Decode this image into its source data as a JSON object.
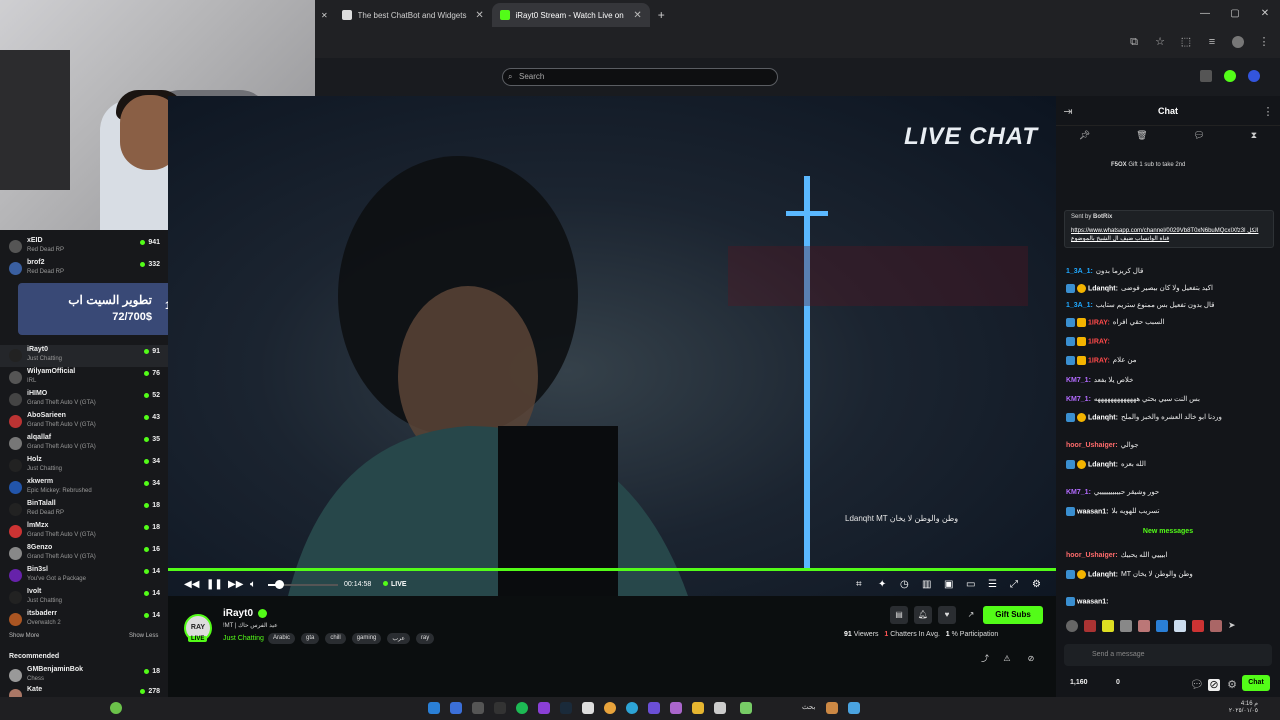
{
  "browser": {
    "tabs": [
      {
        "title": "The best ChatBot and Widgets for Kick, Tw...",
        "active": false
      },
      {
        "title": "iRayt0 Stream - Watch Live on Kick",
        "active": true
      }
    ],
    "new_tab": "+"
  },
  "header": {
    "search_placeholder": "Search"
  },
  "sidebar": {
    "channels": [
      {
        "name": "xEID",
        "game": "Red Dead RP",
        "viewers": "941"
      },
      {
        "name": "brof2",
        "game": "Red Dead RP",
        "viewers": "332"
      },
      {
        "name": "iRayt0",
        "game": "Just Chatting",
        "viewers": "91"
      },
      {
        "name": "WilyamOfficial",
        "game": "IRL",
        "viewers": "76"
      },
      {
        "name": "iHIMO",
        "game": "Grand Theft Auto V (GTA)",
        "viewers": "52"
      },
      {
        "name": "AboSarieen",
        "game": "Grand Theft Auto V (GTA)",
        "viewers": "43"
      },
      {
        "name": "alqallaf",
        "game": "Grand Theft Auto V (GTA)",
        "viewers": "35"
      },
      {
        "name": "Holz",
        "game": "Just Chatting",
        "viewers": "34"
      },
      {
        "name": "xkwerm",
        "game": "Epic Mickey: Rebrushed",
        "viewers": "34"
      },
      {
        "name": "BinTalall",
        "game": "Red Dead RP",
        "viewers": "18"
      },
      {
        "name": "lmMzx",
        "game": "Grand Theft Auto V (GTA)",
        "viewers": "18"
      },
      {
        "name": "8Genzo",
        "game": "Grand Theft Auto V (GTA)",
        "viewers": "16"
      },
      {
        "name": "Bin3sl",
        "game": "You've Got a Package",
        "viewers": "14"
      },
      {
        "name": "Ivolt",
        "game": "Just Chatting",
        "viewers": "14"
      },
      {
        "name": "itsbaderr",
        "game": "Overwatch 2",
        "viewers": "14"
      }
    ],
    "show_more": "Show More",
    "show_less": "Show Less",
    "recommended_label": "Recommended",
    "recommended": [
      {
        "name": "GMBenjaminBok",
        "game": "Chess",
        "viewers": "18"
      },
      {
        "name": "Kate",
        "game": "",
        "viewers": "278"
      }
    ]
  },
  "donation": {
    "title": "تطوير السيت اب",
    "amount": "72/700$",
    "percent": "10%"
  },
  "video": {
    "overlay_title": "LIVE CHAT",
    "subtitle": "Ldanqht MT وطن والوطن لا يخان",
    "time": "00:14:58",
    "live_label": "LIVE",
    "volume_level": 0.15
  },
  "stream_info": {
    "avatar_text": "RAY",
    "live_badge": "LIVE",
    "channel_name": "iRayt0",
    "title": "!MT | عيد الفرس حاك",
    "category": "Just Chatting",
    "tags": [
      "Arabic",
      "gta",
      "chill",
      "gaming",
      "عرب",
      "ray"
    ],
    "gift_label": "Gift Subs",
    "viewers": "91",
    "viewers_label": "Viewers",
    "chatters": "1",
    "chatters_label": "Chatters In Avg.",
    "participation": "1",
    "participation_label": "% Participation"
  },
  "chat": {
    "title": "Chat",
    "pinned_user": "F5OX",
    "pinned_text": "Gift 1 sub to take 2nd",
    "sent_by": "Sent by",
    "bot_name": "BotRix",
    "pinned_link": "https://www.whatsapp.com/channel/0029Vb8T0xN6buMQcxIXfz3l",
    "pinned_sub": "الكل قناة الواتساب ضيف ال الشيخ بالموضوع",
    "messages": [
      {
        "user": "1_3A_1:",
        "text": "قال كريزما بدون",
        "color": "#1fa8ff"
      },
      {
        "user": "Ldanqht:",
        "text": "اكيد بتفعيل ولا كان بيصير فوضى",
        "color": "#ffffff"
      },
      {
        "user": "1_3A_1:",
        "text": "قال بدون تفعيل بس ممنوع ستريم ستايب",
        "color": "#1fa8ff"
      },
      {
        "user": "1IRAY:",
        "text": "السبب حقي افراه",
        "color": "#ff4a4a"
      },
      {
        "user": "1IRAY:",
        "text": "",
        "color": "#ff4a4a"
      },
      {
        "user": "1IRAY:",
        "text": "من علام",
        "color": "#ff4a4a"
      },
      {
        "user": "KM7_1:",
        "text": "خلاص يلا بفعد",
        "color": "#b36bff"
      },
      {
        "user": "KM7_1:",
        "text": "بس النت سيي بحتي هههههههههههههه",
        "color": "#b36bff"
      },
      {
        "user": "Ldanqht:",
        "text": "وردنا ابو خالد العشره والخبز والملح",
        "color": "#ffffff"
      },
      {
        "user": "hoor_Ushaiger:",
        "text": "جوالي",
        "color": "#ff6b6b"
      },
      {
        "user": "Ldanqht:",
        "text": "الله بعزه",
        "color": "#ffffff"
      },
      {
        "user": "KM7_1:",
        "text": "حور وشيقر حبيبيييييييي",
        "color": "#b36bff"
      },
      {
        "user": "waasan1:",
        "text": "تسريب للهويه بلا",
        "color": "#ffffff"
      }
    ],
    "new_messages_label": "New messages",
    "new_messages": [
      {
        "user": "hoor_Ushaiger:",
        "text": "ابيييي الله يحبيك",
        "color": "#ff6b6b"
      },
      {
        "user": "Ldanqht:",
        "text": "MT وطن والوطن لا يخان",
        "color": "#ffffff"
      },
      {
        "user": "waasan1:",
        "text": "",
        "color": "#ffffff"
      }
    ],
    "input_placeholder": "Send a message",
    "points": "1,160",
    "count": "0",
    "send_label": "Chat"
  },
  "taskbar": {
    "search": "بحث",
    "time": "4:16 م",
    "date": "٢٠٢٥/٠١/٠٥"
  }
}
